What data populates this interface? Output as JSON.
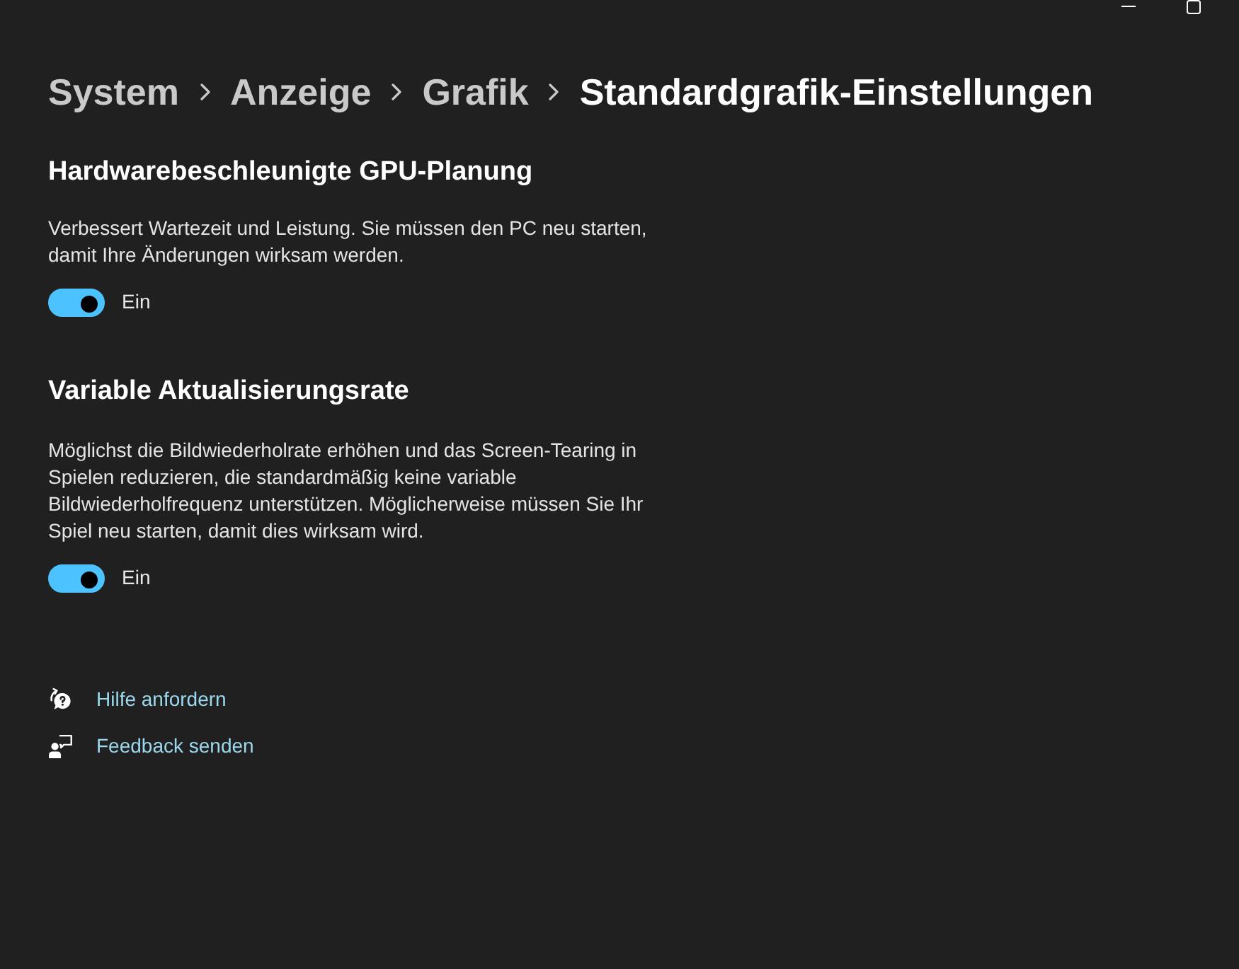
{
  "breadcrumb": [
    {
      "label": "System",
      "selected": false
    },
    {
      "label": "Anzeige",
      "selected": false
    },
    {
      "label": "Grafik",
      "selected": false
    },
    {
      "label": "Standardgrafik-Einstellungen",
      "selected": true
    }
  ],
  "sections": [
    {
      "title": "Hardwarebeschleunigte GPU-Planung",
      "description": "Verbessert Wartezeit und Leistung. Sie müssen den PC neu starten, damit Ihre Änderungen wirksam werden.",
      "toggle": {
        "on": true,
        "label": "Ein"
      }
    },
    {
      "title": "Variable Aktualisierungsrate",
      "description": "Möglichst die Bildwiederholrate erhöhen und das Screen-Tearing in Spielen reduzieren, die standardmäßig keine variable Bildwiederholfrequenz unterstützen. Möglicherweise müssen Sie Ihr Spiel neu starten, damit dies wirksam wird.",
      "toggle": {
        "on": true,
        "label": "Ein"
      }
    }
  ],
  "links": [
    {
      "kind": "help",
      "label": "Hilfe anfordern"
    },
    {
      "kind": "feedback",
      "label": "Feedback senden"
    }
  ]
}
